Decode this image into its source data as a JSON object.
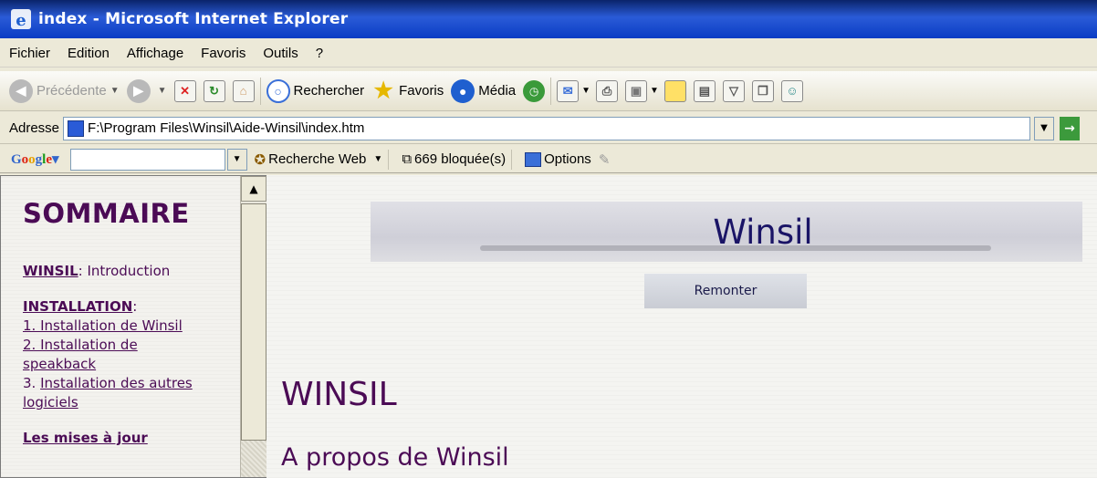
{
  "window": {
    "title": "index - Microsoft Internet Explorer"
  },
  "menu": [
    "Fichier",
    "Edition",
    "Affichage",
    "Favoris",
    "Outils",
    "?"
  ],
  "toolbar": {
    "back": "Précédente",
    "search": "Rechercher",
    "favorites": "Favoris",
    "media": "Média"
  },
  "address": {
    "label": "Adresse",
    "url": "F:\\Program Files\\Winsil\\Aide-Winsil\\index.htm"
  },
  "googlebar": {
    "search_web": "Recherche Web",
    "blocked": "669 bloquée(s)",
    "options": "Options"
  },
  "sidebar": {
    "title": "SOMMAIRE",
    "winsil_link": "WINSIL",
    "winsil_rest": ": Introduction",
    "install_heading": "INSTALLATION",
    "install_colon": ":",
    "install_1": "1. Installation de Winsil",
    "install_2": "2. Installation de speakback",
    "install_3_prefix": "3. ",
    "install_3": "Installation des autres logiciels",
    "updates": "Les mises à jour"
  },
  "main": {
    "banner_title": "Winsil",
    "up_button": "Remonter",
    "heading": "WINSIL",
    "subheading": "A propos de Winsil"
  }
}
